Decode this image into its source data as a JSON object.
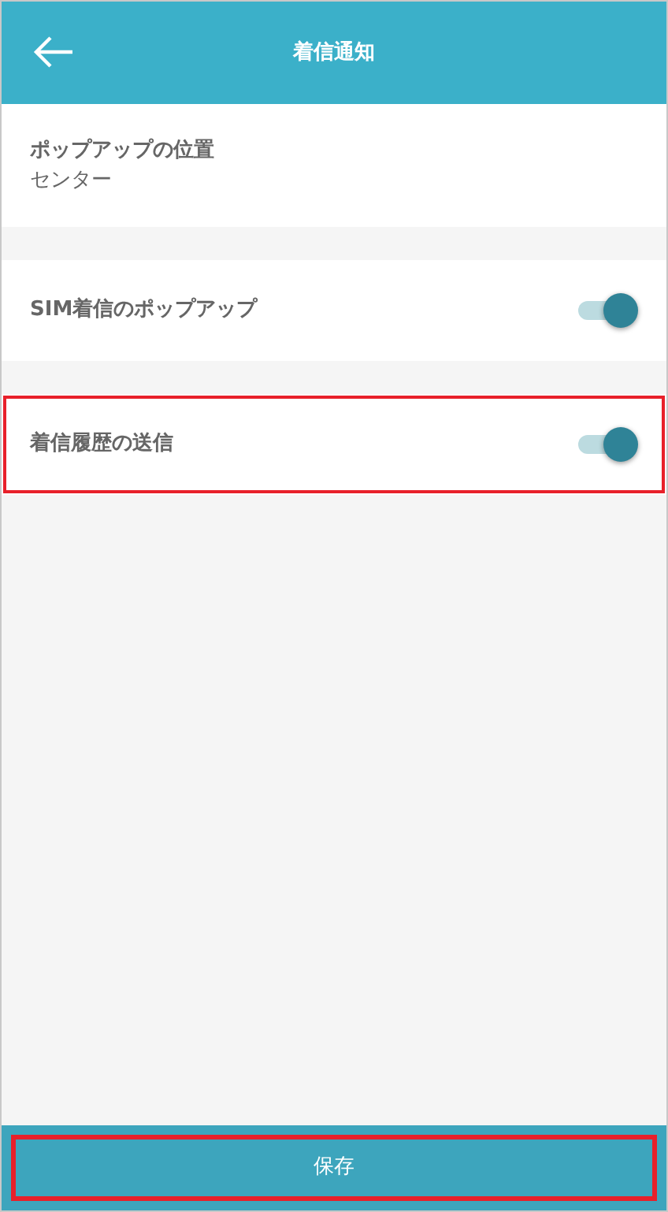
{
  "header": {
    "title": "着信通知"
  },
  "settings": [
    {
      "kind": "value",
      "label": "ポップアップの位置",
      "value": "センター",
      "highlighted": false
    },
    {
      "kind": "toggle",
      "label": "SIM着信のポップアップ",
      "on": true,
      "highlighted": false
    },
    {
      "kind": "toggle",
      "label": "着信履歴の送信",
      "on": true,
      "highlighted": true
    }
  ],
  "save_button": {
    "label": "保存",
    "highlighted": true
  }
}
